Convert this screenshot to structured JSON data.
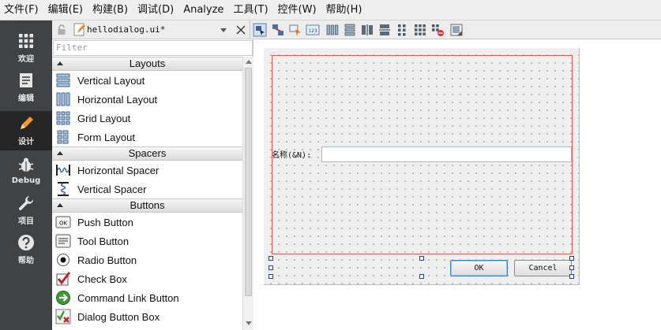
{
  "menubar": {
    "items": [
      "文件(F)",
      "编辑(E)",
      "构建(B)",
      "调试(D)",
      "Analyze",
      "工具(T)",
      "控件(W)",
      "帮助(H)"
    ]
  },
  "modes": [
    {
      "label": "欢迎",
      "icon": "grid-icon"
    },
    {
      "label": "编辑",
      "icon": "document-icon"
    },
    {
      "label": "设计",
      "icon": "pencil-icon",
      "active": true
    },
    {
      "label": "Debug",
      "icon": "bug-icon"
    },
    {
      "label": "项目",
      "icon": "wrench-icon"
    },
    {
      "label": "帮助",
      "icon": "help-icon"
    }
  ],
  "doc": {
    "file_name": "hellodialog.ui*"
  },
  "widgetbox": {
    "filter_placeholder": "Filter",
    "categories": [
      {
        "name": "Layouts",
        "items": [
          "Vertical Layout",
          "Horizontal Layout",
          "Grid Layout",
          "Form Layout"
        ]
      },
      {
        "name": "Spacers",
        "items": [
          "Horizontal Spacer",
          "Vertical Spacer"
        ]
      },
      {
        "name": "Buttons",
        "items": [
          "Push Button",
          "Tool Button",
          "Radio Button",
          "Check Box",
          "Command Link Button",
          "Dialog Button Box"
        ]
      }
    ]
  },
  "form": {
    "name_label": "名称(&N):",
    "name_value": "",
    "ok_label": "OK",
    "cancel_label": "Cancel"
  },
  "colors": {
    "modebar": "#404244",
    "mode_active": "#262626",
    "layout_outline": "#e05a5a",
    "selection_handle": "#1e3fb8"
  }
}
